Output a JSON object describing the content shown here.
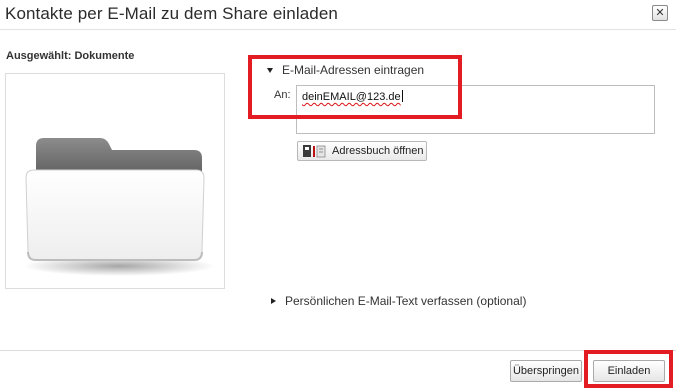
{
  "dialog": {
    "title": "Kontakte per E-Mail zu dem Share einladen",
    "close_symbol": "✕"
  },
  "selection": {
    "label": "Ausgewählt: Dokumente",
    "icon": "folder-icon"
  },
  "email_section": {
    "header": "E-Mail-Adressen eintragen",
    "expanded": true,
    "to_label": "An:",
    "value": "deinEMAIL@123.de",
    "addressbook_button": "Adressbuch öffnen",
    "addressbook_icon": "addressbook-icon"
  },
  "message_section": {
    "header": "Persönlichen E-Mail-Text verfassen (optional)",
    "expanded": false
  },
  "footer": {
    "skip_label": "Überspringen",
    "invite_label": "Einladen"
  },
  "colors": {
    "highlight": "#e31b23"
  }
}
